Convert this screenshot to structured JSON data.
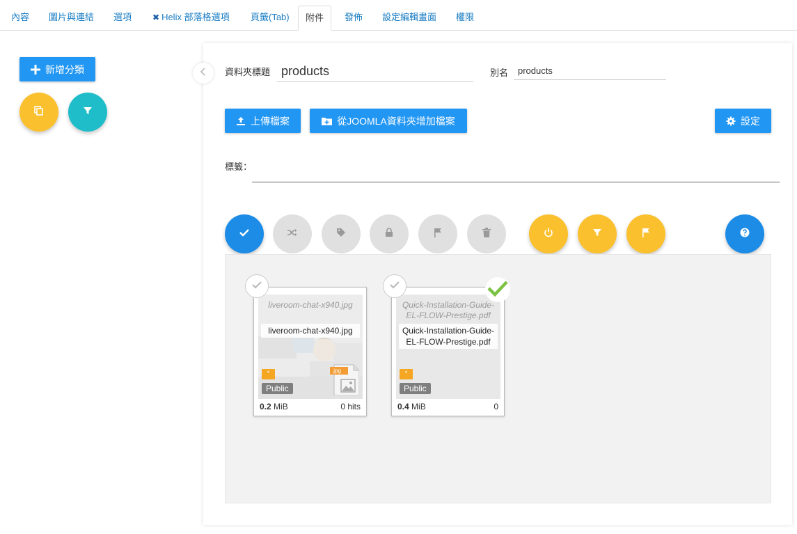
{
  "tabs": [
    {
      "label": "內容",
      "active": false
    },
    {
      "label": "圖片與連結",
      "active": false
    },
    {
      "label": "選項",
      "active": false
    },
    {
      "label": "Helix 部落格選項",
      "active": false,
      "icon": "joomla-icon"
    },
    {
      "label": "頁籤(Tab)",
      "active": false
    },
    {
      "label": "附件",
      "active": true
    },
    {
      "label": "發佈",
      "active": false
    },
    {
      "label": "設定編輯畫面",
      "active": false
    },
    {
      "label": "權限",
      "active": false
    }
  ],
  "sidebar": {
    "add_category_label": "新增分類",
    "buttons": [
      {
        "icon": "copy-icon",
        "color": "#fbc02d"
      },
      {
        "icon": "filter-icon",
        "color": "#1ebdc9"
      }
    ]
  },
  "folder": {
    "title_label": "資料夾標題",
    "title_value": "products",
    "alias_label": "別名",
    "alias_value": "products"
  },
  "actions": {
    "upload_label": "上傳檔案",
    "add_from_joomla_label": "從JOOMLA資料夾增加檔案",
    "settings_label": "設定"
  },
  "tags": {
    "label": "標籤："
  },
  "toolbar": [
    {
      "icon": "check-icon",
      "color": "#1c8ce6",
      "enabled": true
    },
    {
      "icon": "shuffle-icon",
      "color": "#e0e0e0",
      "enabled": false
    },
    {
      "icon": "tag-icon",
      "color": "#e0e0e0",
      "enabled": false
    },
    {
      "icon": "lock-icon",
      "color": "#e0e0e0",
      "enabled": false
    },
    {
      "icon": "flag-icon",
      "color": "#e0e0e0",
      "enabled": false
    },
    {
      "icon": "trash-icon",
      "color": "#e0e0e0",
      "enabled": false
    },
    {
      "icon": "power-icon",
      "color": "#fbc02d",
      "enabled": true
    },
    {
      "icon": "filter-icon",
      "color": "#fbc02d",
      "enabled": true
    },
    {
      "icon": "flag-icon",
      "color": "#fbc02d",
      "enabled": true
    },
    {
      "icon": "help-icon",
      "color": "#1c8ce6",
      "enabled": true
    }
  ],
  "files": [
    {
      "title": "liveroom-chat-x940.jpg",
      "filename": "liveroom-chat-x940.jpg",
      "ext": ".jpg",
      "lock_badge": "*",
      "access": "Public",
      "size_value": "0.2",
      "size_unit": "MiB",
      "hits": "0 hits",
      "selected": false
    },
    {
      "title": "Quick-Installation-Guide-EL-FLOW-Prestige.pdf",
      "filename": "Quick-Installation-Guide-EL-FLOW-Prestige.pdf",
      "lock_badge": "*",
      "access": "Public",
      "size_value": "0.4",
      "size_unit": "MiB",
      "hits": "0",
      "selected": true
    }
  ]
}
